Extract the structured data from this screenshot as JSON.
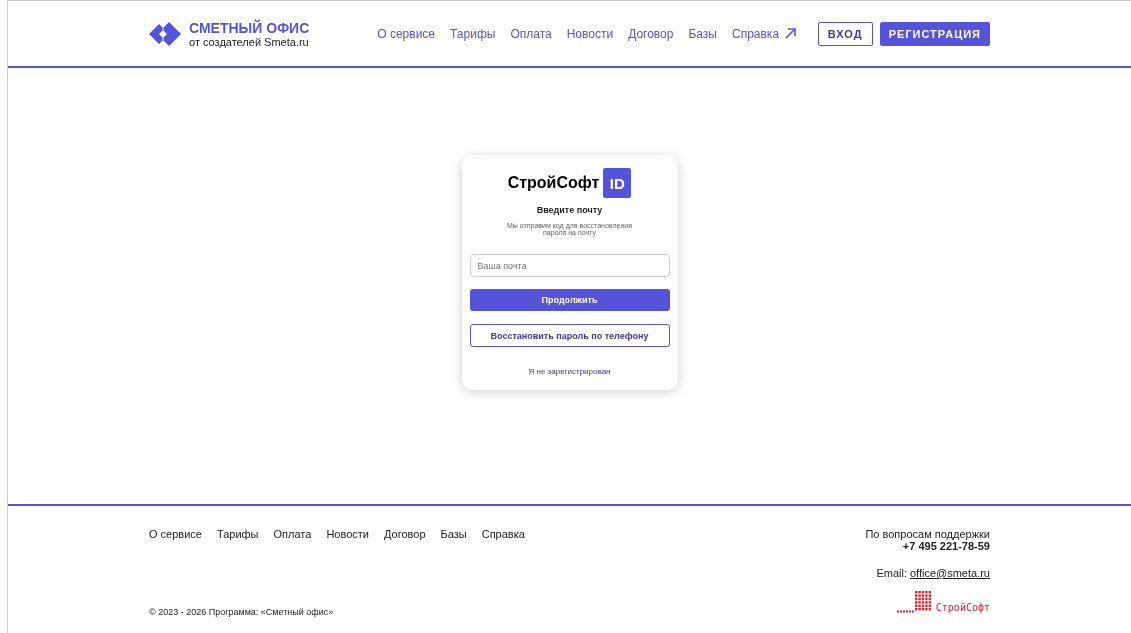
{
  "header": {
    "logo": {
      "title": "СМЕТНЫЙ ОФИС",
      "subtitle": "от создателей Smeta.ru"
    },
    "nav": [
      {
        "label": "О сервисе",
        "external": false
      },
      {
        "label": "Тарифы",
        "external": false
      },
      {
        "label": "Оплата",
        "external": false
      },
      {
        "label": "Новости",
        "external": false
      },
      {
        "label": "Договор",
        "external": false
      },
      {
        "label": "Базы",
        "external": false
      },
      {
        "label": "Справка",
        "external": true
      }
    ],
    "login_button": "ВХОД",
    "register_button": "РЕГИСТРАЦИЯ"
  },
  "card": {
    "brand": "СтройСофт",
    "brand_badge": "ID",
    "title": "Введите почту",
    "subtitle": "Мы отправим код для восстановления\nпароля на почту",
    "email_field": {
      "placeholder": "Ваша почта"
    },
    "primary_button": "Продолжить",
    "secondary_button": "Восстановить пароль по телефону",
    "link": "Я не зарегистрирован"
  },
  "footer": {
    "nav": [
      "О сервисе",
      "Тарифы",
      "Оплата",
      "Новости",
      "Договор",
      "Базы",
      "Справка"
    ],
    "support_label": "По вопросам поддержки",
    "phone": "+7 495 221-78-59",
    "email_label": "Email:",
    "email": "office@smeta.ru",
    "copyright": "© 2023 - 2026 Программа: «Сметный офис»",
    "company_logo": "СтройСофт"
  }
}
